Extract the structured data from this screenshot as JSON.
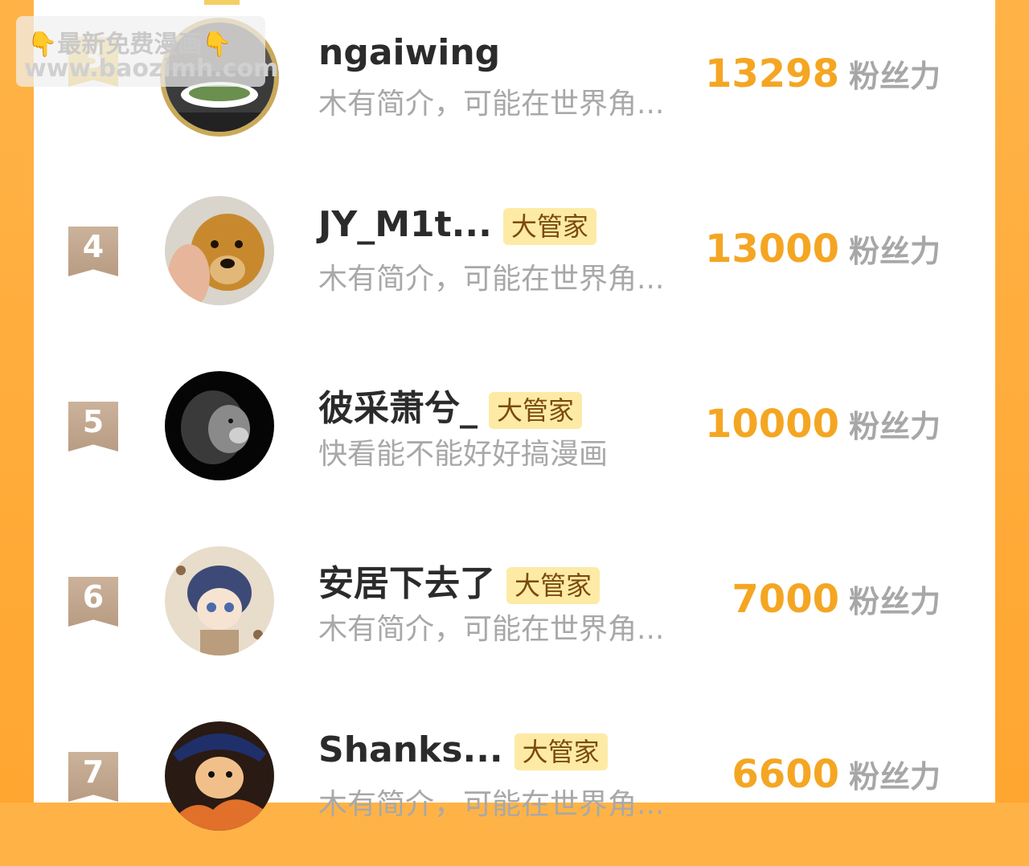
{
  "watermark": {
    "title": "👇最新免费漫画👇",
    "url": "www.baozimh.com"
  },
  "fans_unit": "粉丝力",
  "tag_label": "大管家",
  "rows": [
    {
      "rank": "3",
      "name": "ngaiwing",
      "bio": "木有简介，可能在世界角...",
      "fans": "13298"
    },
    {
      "rank": "4",
      "name": "JY_M1t...",
      "bio": "木有简介，可能在世界角...",
      "fans": "13000"
    },
    {
      "rank": "5",
      "name": "彼采萧兮_",
      "bio": "快看能不能好好搞漫画",
      "fans": "10000"
    },
    {
      "rank": "6",
      "name": "安居下去了",
      "bio": "木有简介，可能在世界角...",
      "fans": "7000"
    },
    {
      "rank": "7",
      "name": "Shanks...",
      "bio": "木有简介，可能在世界角...",
      "fans": "6600"
    }
  ],
  "colors": {
    "accent": "#f4a623",
    "tag_bg": "#fdeaa5",
    "side_bg": "#ffa630"
  }
}
